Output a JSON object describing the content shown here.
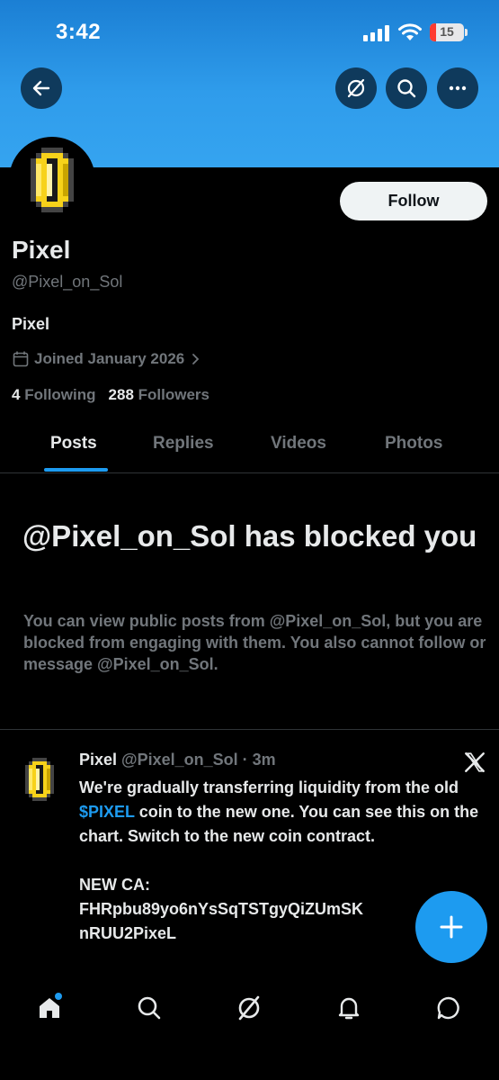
{
  "status_bar": {
    "time": "3:42",
    "battery": "15"
  },
  "header": {
    "back_icon": "arrow-left-icon",
    "grok_icon": "grok-icon",
    "search_icon": "search-icon",
    "more_icon": "more-icon",
    "banner_color": "#2f9ceb"
  },
  "profile": {
    "display_name": "Pixel",
    "handle": "@Pixel_on_Sol",
    "bio": "Pixel",
    "joined": "Joined January 2026",
    "following_count": "4",
    "following_label": "Following",
    "followers_count": "288",
    "followers_label": "Followers",
    "follow_button": "Follow"
  },
  "tabs": [
    "Posts",
    "Replies",
    "Videos",
    "Photos"
  ],
  "blocked": {
    "title": "@Pixel_on_Sol has blocked you",
    "description": "You can view public posts from @Pixel_on_Sol, but you are blocked from engaging with them. You also cannot follow or message @Pixel_on_Sol."
  },
  "post": {
    "name": "Pixel",
    "handle_time": "@Pixel_on_Sol · 3m",
    "text_before": "We're gradually transferring liquidity from the old ",
    "cashtag": "$PIXEL",
    "text_after": " coin to the new one. You can see this on the chart. Switch to the new coin contract.",
    "ca_label": "NEW CA:",
    "ca_line1": "FHRpbu89yo6nYsSqTSTgyQiZUmSK",
    "ca_line2": "nRUU2PixeL"
  },
  "colors": {
    "accent": "#1d9bf0",
    "muted": "#71767b"
  },
  "bottom_nav": [
    "home-icon",
    "search-icon",
    "grok-icon",
    "notifications-icon",
    "messages-icon"
  ]
}
